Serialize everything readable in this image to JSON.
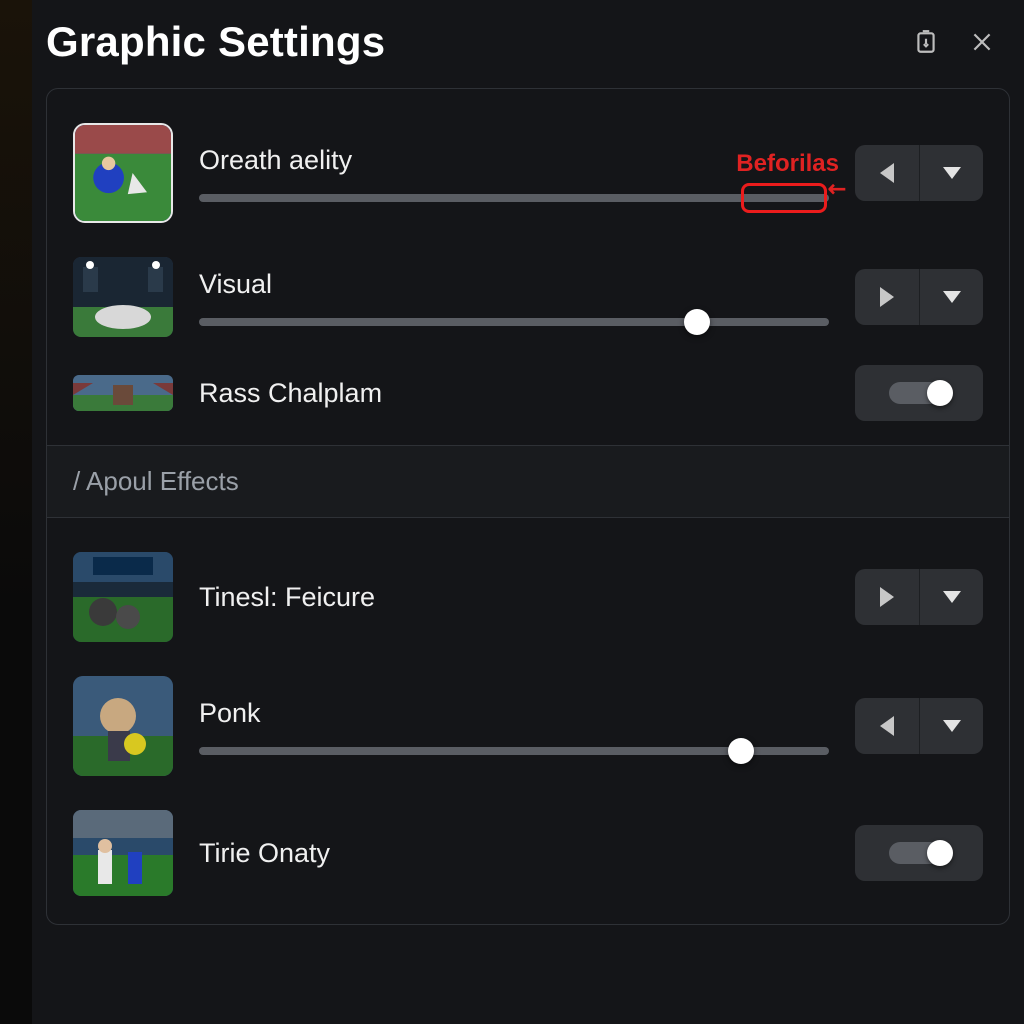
{
  "title": "Graphic Settings",
  "annotation": {
    "text": "Beforilas"
  },
  "section_header": "/ Apoul Effects",
  "rows": {
    "r1": {
      "label": "Oreath aelity",
      "slider_percent": 98
    },
    "r2": {
      "label": "Visual",
      "slider_percent": 79
    },
    "r3": {
      "label": "Rass Chalplam"
    },
    "r4": {
      "label": "Tinesl: Feicure"
    },
    "r5": {
      "label": "Ponk",
      "slider_percent": 86
    },
    "r6": {
      "label": "Tirie Onaty"
    }
  }
}
